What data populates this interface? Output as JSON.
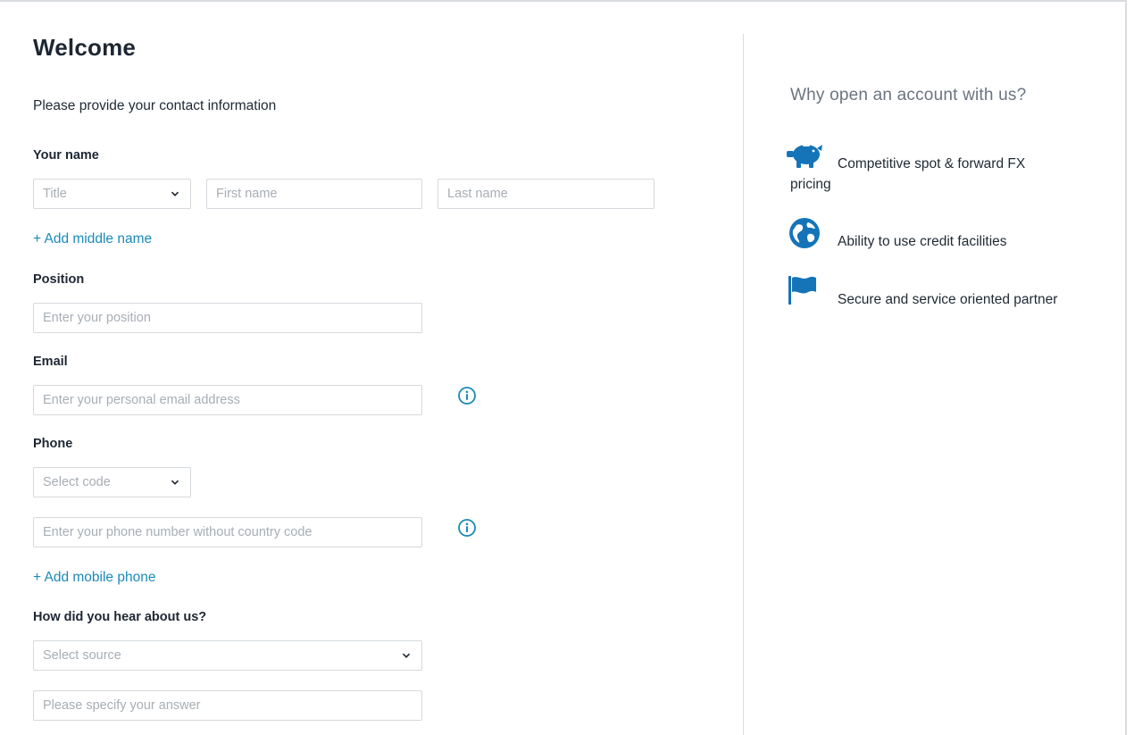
{
  "form": {
    "title": "Welcome",
    "subtitle": "Please provide your contact information",
    "name": {
      "label": "Your name",
      "title_placeholder": "Title",
      "first_placeholder": "First name",
      "last_placeholder": "Last name",
      "add_middle": "+ Add middle name"
    },
    "position": {
      "label": "Position",
      "placeholder": "Enter your position"
    },
    "email": {
      "label": "Email",
      "placeholder": "Enter your personal email address"
    },
    "phone": {
      "label": "Phone",
      "code_placeholder": "Select code",
      "number_placeholder": "Enter your phone number without country code",
      "add_mobile": "+ Add mobile phone"
    },
    "source": {
      "label": "How did you hear about us?",
      "select_placeholder": "Select source",
      "answer_placeholder": "Please specify your answer"
    }
  },
  "aside": {
    "title": "Why open an account with us?",
    "benefits": [
      {
        "icon": "piggy-bank-icon",
        "text": "Competitive spot & forward FX pricing"
      },
      {
        "icon": "globe-icon",
        "text": "Ability to use credit facilities"
      },
      {
        "icon": "flag-icon",
        "text": "Secure and service oriented partner"
      }
    ]
  },
  "colors": {
    "accent": "#1a8ab8",
    "icon_blue": "#1574b8",
    "border": "#d5d9dd",
    "placeholder": "#a7aeb5"
  }
}
